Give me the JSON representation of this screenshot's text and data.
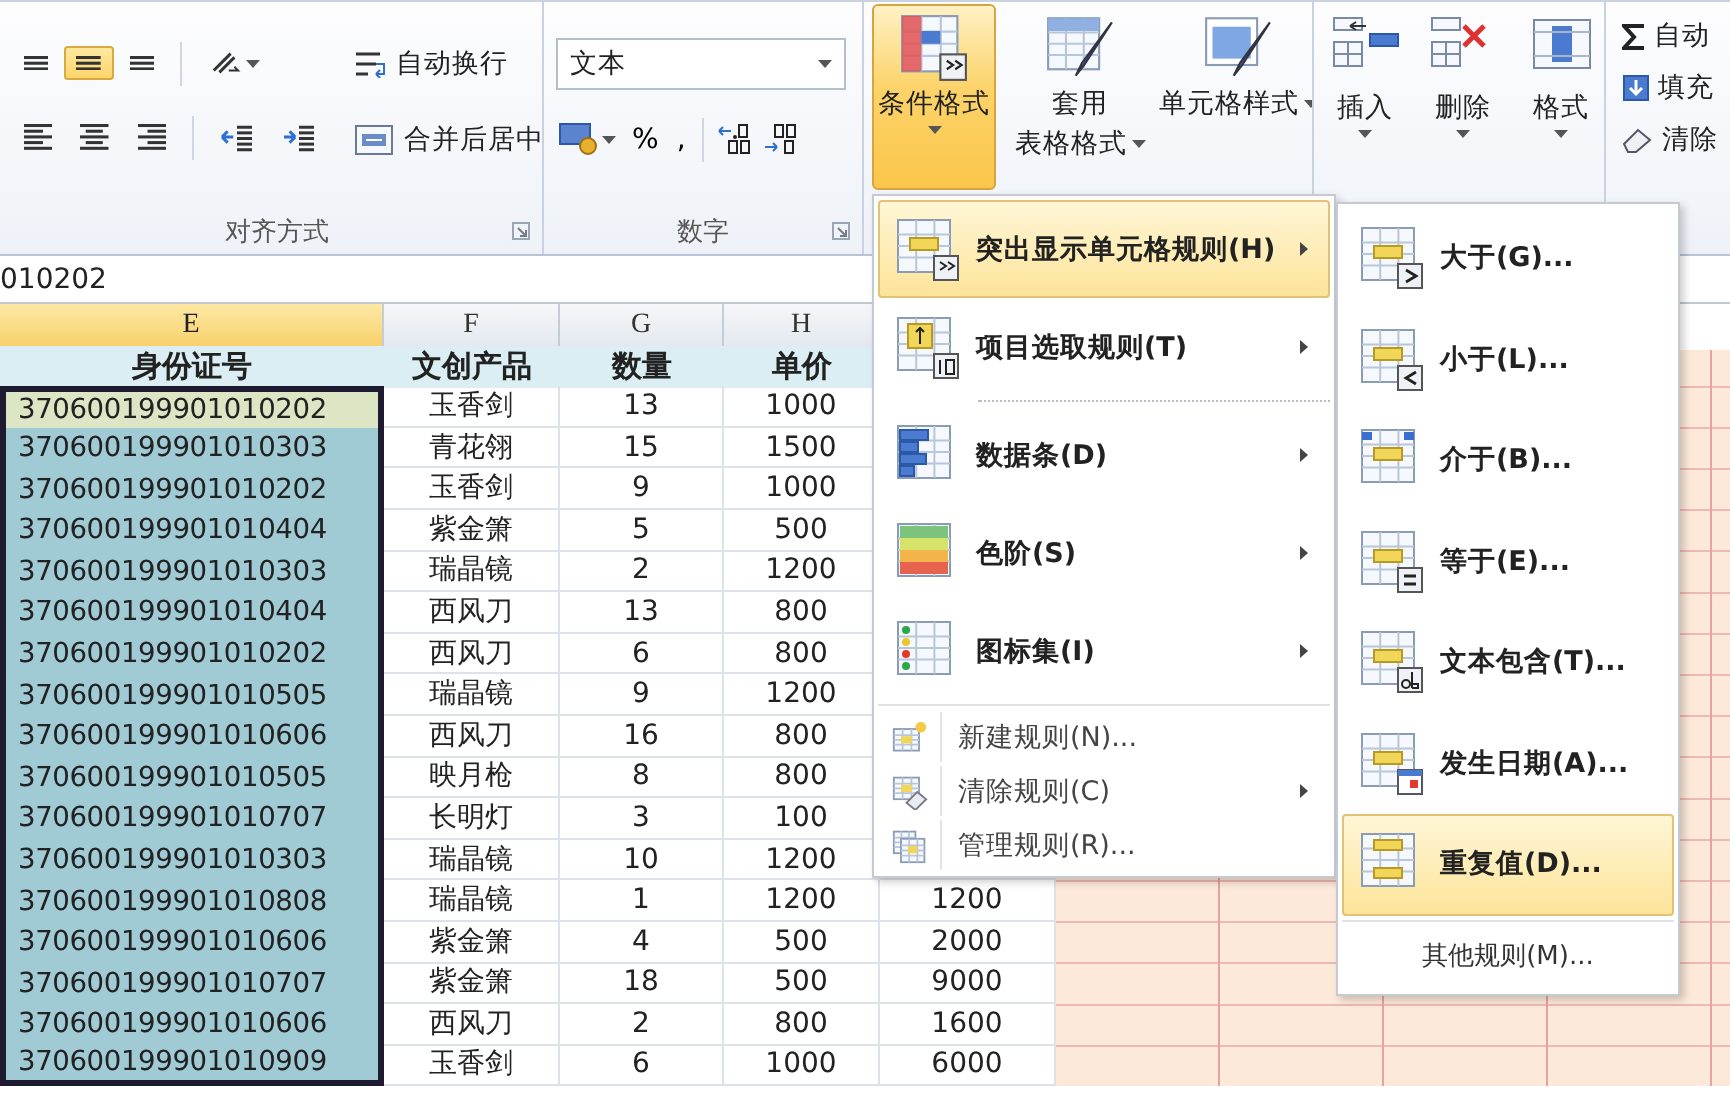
{
  "ribbon": {
    "alignment_group": {
      "label": "对齐方式",
      "align_buttons": [
        {
          "selected": false
        },
        {
          "selected": true
        },
        {
          "selected": false
        },
        {
          "selected": false
        },
        {
          "selected": false
        },
        {
          "selected": false
        },
        {
          "selected": false
        },
        {
          "selected": false
        },
        {
          "selected": false
        }
      ],
      "wrap_text": "自动换行",
      "merge_center": "合并后居中"
    },
    "number_group": {
      "label": "数字",
      "format": "文本",
      "percent": "%",
      "comma": ","
    },
    "styles_group": {
      "buttons": [
        {
          "lines": [
            "条件格式"
          ],
          "selected": true
        },
        {
          "lines": [
            "套用",
            "表格格式"
          ],
          "selected": false
        },
        {
          "lines": [
            "单元格样式"
          ],
          "selected": false
        }
      ]
    },
    "cells_group": {
      "buttons": [
        {
          "label": "插入"
        },
        {
          "label": "删除"
        },
        {
          "label": "格式"
        }
      ]
    },
    "editing_group": {
      "items": [
        {
          "label": "自动"
        },
        {
          "label": "填充"
        },
        {
          "label": "清除"
        }
      ]
    }
  },
  "formula_bar": {
    "value": "010202"
  },
  "sheet": {
    "column_headers": [
      {
        "label": "E",
        "selected": true
      },
      {
        "label": "F",
        "selected": false
      },
      {
        "label": "G",
        "selected": false
      },
      {
        "label": "H",
        "selected": false
      }
    ],
    "header_row": [
      "身份证号",
      "文创产品",
      "数量",
      "单价"
    ],
    "rows": [
      {
        "active": true,
        "cells": [
          "370600199901010202",
          "玉香剑",
          "13",
          "1000"
        ]
      },
      {
        "active": false,
        "cells": [
          "370600199901010303",
          "青花翎",
          "15",
          "1500"
        ]
      },
      {
        "active": false,
        "cells": [
          "370600199901010202",
          "玉香剑",
          "9",
          "1000"
        ]
      },
      {
        "active": false,
        "cells": [
          "370600199901010404",
          "紫金箫",
          "5",
          "500"
        ]
      },
      {
        "active": false,
        "cells": [
          "370600199901010303",
          "瑞晶镜",
          "2",
          "1200"
        ]
      },
      {
        "active": false,
        "cells": [
          "370600199901010404",
          "西风刀",
          "13",
          "800"
        ]
      },
      {
        "active": false,
        "cells": [
          "370600199901010202",
          "西风刀",
          "6",
          "800"
        ]
      },
      {
        "active": false,
        "cells": [
          "370600199901010505",
          "瑞晶镜",
          "9",
          "1200"
        ]
      },
      {
        "active": false,
        "cells": [
          "370600199901010606",
          "西风刀",
          "16",
          "800"
        ]
      },
      {
        "active": false,
        "cells": [
          "370600199901010505",
          "映月枪",
          "8",
          "800"
        ]
      },
      {
        "active": false,
        "cells": [
          "370600199901010707",
          "长明灯",
          "3",
          "100"
        ]
      },
      {
        "active": false,
        "cells": [
          "370600199901010303",
          "瑞晶镜",
          "10",
          "1200"
        ]
      },
      {
        "active": false,
        "cells": [
          "370600199901010808",
          "瑞晶镜",
          "1",
          "1200",
          "1200"
        ]
      },
      {
        "active": false,
        "cells": [
          "370600199901010606",
          "紫金箫",
          "4",
          "500",
          "2000"
        ]
      },
      {
        "active": false,
        "cells": [
          "370600199901010707",
          "紫金箫",
          "18",
          "500",
          "9000"
        ]
      },
      {
        "active": false,
        "cells": [
          "370600199901010606",
          "西风刀",
          "2",
          "800",
          "1600"
        ]
      },
      {
        "active": false,
        "cells": [
          "370600199901010909",
          "玉香剑",
          "6",
          "1000",
          "6000"
        ]
      }
    ]
  },
  "menu": {
    "items": [
      {
        "kind": "rule",
        "label": "突出显示单元格规则(H)",
        "selected": true,
        "submenu": true
      },
      {
        "kind": "rule",
        "label": "项目选取规则(T)",
        "selected": false,
        "submenu": true
      },
      {
        "kind": "rule",
        "label": "数据条(D)",
        "selected": false,
        "submenu": true
      },
      {
        "kind": "rule",
        "label": "色阶(S)",
        "selected": false,
        "submenu": true
      },
      {
        "kind": "rule",
        "label": "图标集(I)",
        "selected": false,
        "submenu": true
      },
      {
        "kind": "command",
        "label": "新建规则(N)...",
        "selected": false,
        "submenu": false
      },
      {
        "kind": "command",
        "label": "清除规则(C)",
        "selected": false,
        "submenu": true
      },
      {
        "kind": "command",
        "label": "管理规则(R)...",
        "selected": false,
        "submenu": false
      }
    ]
  },
  "submenu": {
    "items": [
      {
        "label": "大于(G)...",
        "selected": false
      },
      {
        "label": "小于(L)...",
        "selected": false
      },
      {
        "label": "介于(B)...",
        "selected": false
      },
      {
        "label": "等于(E)...",
        "selected": false
      },
      {
        "label": "文本包含(T)...",
        "selected": false
      },
      {
        "label": "发生日期(A)...",
        "selected": false
      },
      {
        "label": "重复值(D)...",
        "selected": true
      }
    ],
    "more": "其他规则(M)..."
  }
}
